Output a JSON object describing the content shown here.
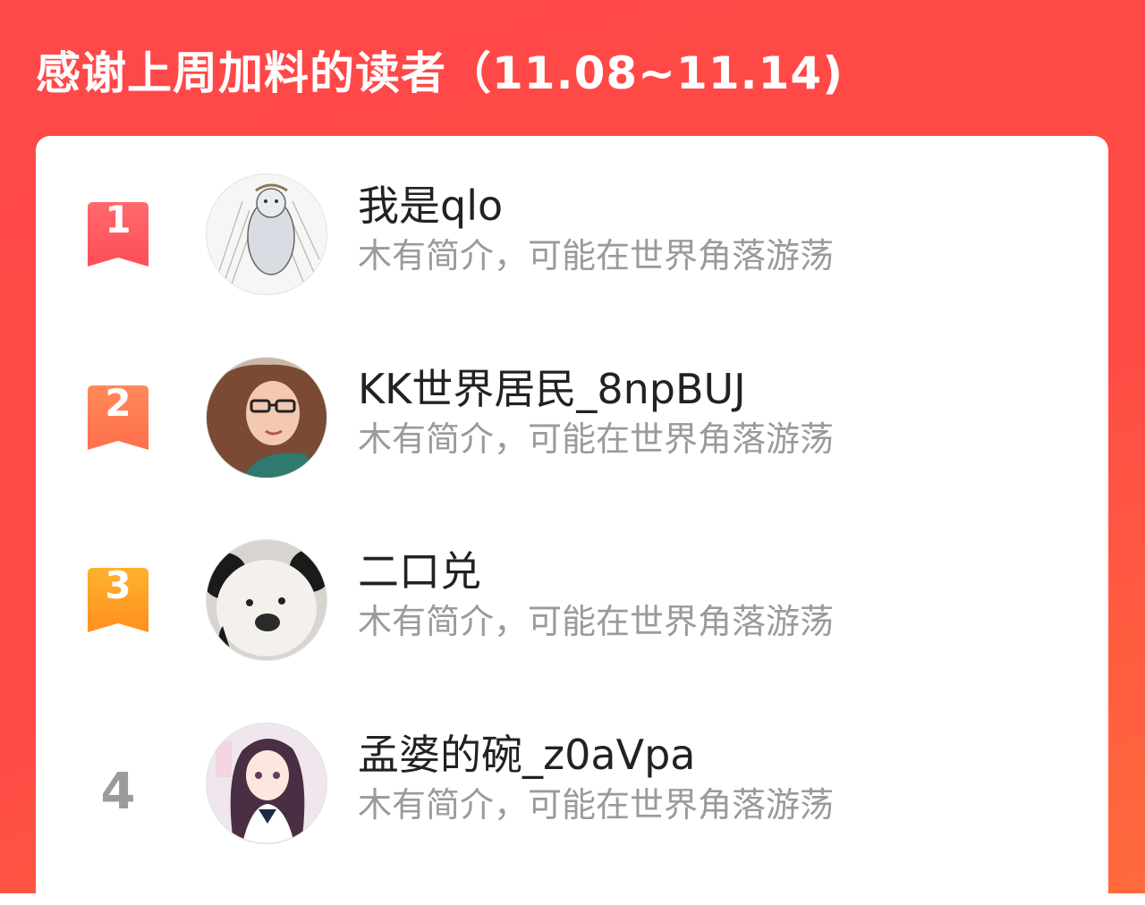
{
  "header": {
    "title": "感谢上周加料的读者（11.08~11.14)"
  },
  "readers": [
    {
      "rank": "1",
      "name": "我是qlo",
      "intro": "木有简介，可能在世界角落游荡",
      "badge_color_top": "#ff6a6e",
      "badge_color_bottom": "#ff4d57"
    },
    {
      "rank": "2",
      "name": "KK世界居民_8npBUJ",
      "intro": "木有简介，可能在世界角落游荡",
      "badge_color_top": "#ff8a5a",
      "badge_color_bottom": "#ff6f4b"
    },
    {
      "rank": "3",
      "name": "二口兑",
      "intro": "木有简介，可能在世界角落游荡",
      "badge_color_top": "#ffb12d",
      "badge_color_bottom": "#ff8f1f"
    },
    {
      "rank": "4",
      "name": "孟婆的碗_z0aVpa",
      "intro": "木有简介，可能在世界角落游荡"
    }
  ]
}
